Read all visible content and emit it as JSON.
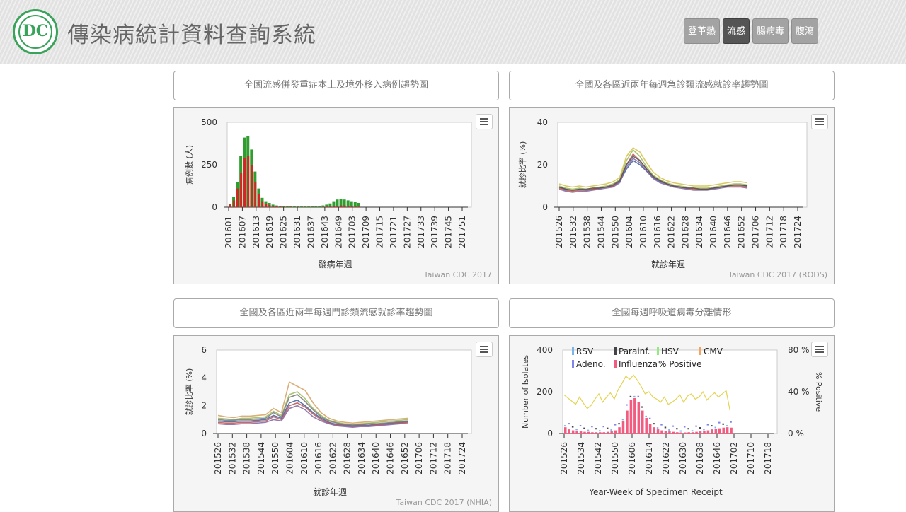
{
  "header": {
    "logo_text": "DC",
    "title": "傳染病統計資料查詢系統",
    "nav": [
      {
        "label": "登革熱",
        "active": false
      },
      {
        "label": "流感",
        "active": true
      },
      {
        "label": "腸病毒",
        "active": false
      },
      {
        "label": "腹瀉",
        "active": false
      }
    ]
  },
  "panels": [
    {
      "title": "全國流感併發重症本土及境外移入病例趨勢圖",
      "credit": "Taiwan CDC 2017"
    },
    {
      "title": "全國及各區近兩年每週急診類流感就診率趨勢圖",
      "credit": "Taiwan CDC 2017 (RODS)"
    },
    {
      "title": "全國及各區近兩年每週門診類流感就診率趨勢圖",
      "credit": "Taiwan CDC 2017 (NHIA)"
    },
    {
      "title": "全國每週呼吸道病毒分離情形",
      "credit": ""
    }
  ],
  "chart_data": [
    {
      "type": "bar",
      "ylabel": "病例數 (人)",
      "xlabel": "發病年週",
      "ylim": [
        0,
        500
      ],
      "yticks": [
        "0",
        "250",
        "500"
      ],
      "xtick_labels": [
        "201601",
        "201607",
        "201613",
        "201619",
        "201625",
        "201631",
        "201637",
        "201643",
        "201649",
        "201703",
        "201709",
        "201715",
        "201721",
        "201727",
        "201733",
        "201739",
        "201745",
        "201751"
      ],
      "series": [
        {
          "name": "",
          "color": "#d62424",
          "values": [
            15,
            40,
            110,
            200,
            290,
            300,
            250,
            150,
            75,
            35,
            20,
            12,
            6,
            4,
            3,
            2,
            2,
            2,
            1,
            1,
            1,
            1,
            1,
            1,
            1,
            1,
            2,
            3,
            4,
            6,
            8,
            10,
            10,
            8,
            6,
            4,
            3
          ]
        },
        {
          "name": "",
          "color": "#2f9e2f",
          "values": [
            20,
            60,
            150,
            300,
            410,
            420,
            340,
            210,
            110,
            55,
            35,
            25,
            15,
            10,
            8,
            6,
            6,
            6,
            5,
            5,
            4,
            4,
            4,
            5,
            6,
            8,
            10,
            15,
            22,
            35,
            45,
            50,
            45,
            40,
            35,
            30,
            25
          ]
        }
      ]
    },
    {
      "type": "line",
      "ylabel": "就診比率 (%)",
      "xlabel": "就診年週",
      "ylim": [
        0,
        40
      ],
      "yticks": [
        "0",
        "20",
        "40"
      ],
      "xtick_labels": [
        "201526",
        "201532",
        "201538",
        "201544",
        "201550",
        "201604",
        "201610",
        "201616",
        "201622",
        "201628",
        "201634",
        "201640",
        "201646",
        "201652",
        "201706",
        "201712",
        "201718",
        "201724"
      ],
      "series": [
        {
          "name": "",
          "color": "#3a5fa0",
          "values": [
            9.5,
            8.5,
            8,
            8.5,
            8,
            8.5,
            9,
            9.5,
            10,
            12,
            18,
            22,
            20,
            17,
            14,
            12,
            11,
            10,
            9.5,
            9,
            9,
            8.5,
            8.5,
            9,
            9.5,
            10,
            10.5,
            10.5,
            10
          ]
        },
        {
          "name": "",
          "color": "#9bbb59",
          "values": [
            10,
            9,
            8.5,
            9,
            8.5,
            9,
            9.5,
            10,
            11,
            13,
            22,
            27,
            24,
            19,
            15,
            13,
            11.5,
            10.5,
            10,
            9.5,
            9,
            9,
            9,
            9.5,
            10,
            10.5,
            11,
            11,
            10.5
          ]
        },
        {
          "name": "",
          "color": "#c0504d",
          "values": [
            9,
            8,
            7.5,
            8,
            8,
            8.5,
            9,
            9.5,
            10,
            12.5,
            20,
            25,
            22,
            18,
            14.5,
            12.5,
            11,
            10,
            9.5,
            9,
            8.5,
            8.5,
            8.5,
            9,
            9.5,
            10,
            10,
            10,
            9.5
          ]
        },
        {
          "name": "",
          "color": "#d6c046",
          "values": [
            11,
            10,
            9.5,
            10,
            9.5,
            10,
            10.5,
            11,
            12,
            14,
            24,
            28,
            26,
            21,
            16.5,
            14,
            12.5,
            11.5,
            11,
            10.5,
            10,
            10,
            10,
            10.5,
            11,
            11.5,
            12,
            12,
            11.5
          ]
        },
        {
          "name": "",
          "color": "#8064a2",
          "values": [
            8.5,
            7.5,
            7,
            7.5,
            7.5,
            8,
            8.5,
            9,
            9.5,
            11.5,
            19,
            23,
            21,
            17,
            13.5,
            11.5,
            10.5,
            9.5,
            9,
            8.5,
            8,
            8,
            8,
            8.5,
            9,
            9.5,
            9.5,
            9.5,
            9
          ]
        },
        {
          "name": "",
          "color": "#555555",
          "values": [
            9.5,
            8.5,
            8,
            8.5,
            8.5,
            9,
            9,
            9.5,
            10.5,
            12.5,
            20,
            24,
            22,
            18,
            14.5,
            12.5,
            11,
            10,
            9.5,
            9,
            9,
            8.5,
            8.5,
            9,
            9.5,
            10,
            10.5,
            10.5,
            10
          ]
        }
      ]
    },
    {
      "type": "line",
      "ylabel": "就診比率 (%)",
      "xlabel": "就診年週",
      "ylim": [
        0,
        6
      ],
      "yticks": [
        "0",
        "2",
        "4",
        "6"
      ],
      "xtick_labels": [
        "201526",
        "201532",
        "201538",
        "201544",
        "201550",
        "201604",
        "201610",
        "201616",
        "201622",
        "201628",
        "201634",
        "201640",
        "201646",
        "201652",
        "201706",
        "201712",
        "201718",
        "201724"
      ],
      "series": [
        {
          "name": "",
          "color": "#3a5fa0",
          "values": [
            0.9,
            0.85,
            0.85,
            0.9,
            0.9,
            0.95,
            1.0,
            1.3,
            1.1,
            2.2,
            2.4,
            2.0,
            1.5,
            1.1,
            0.8,
            0.65,
            0.6,
            0.55,
            0.6,
            0.6,
            0.65,
            0.7,
            0.75,
            0.8,
            0.85
          ]
        },
        {
          "name": "",
          "color": "#9bbb59",
          "values": [
            1.1,
            1.05,
            1.0,
            1.1,
            1.1,
            1.15,
            1.2,
            1.6,
            1.3,
            2.8,
            3.0,
            2.5,
            1.8,
            1.3,
            0.95,
            0.8,
            0.7,
            0.65,
            0.7,
            0.75,
            0.8,
            0.85,
            0.9,
            0.95,
            1.0
          ]
        },
        {
          "name": "",
          "color": "#c0504d",
          "values": [
            0.8,
            0.75,
            0.75,
            0.8,
            0.8,
            0.85,
            0.9,
            1.2,
            1.0,
            2.0,
            2.2,
            1.9,
            1.4,
            1.0,
            0.75,
            0.6,
            0.55,
            0.5,
            0.55,
            0.55,
            0.6,
            0.65,
            0.7,
            0.75,
            0.8
          ]
        },
        {
          "name": "",
          "color": "#d6a060",
          "values": [
            1.3,
            1.2,
            1.15,
            1.25,
            1.25,
            1.3,
            1.35,
            1.8,
            1.5,
            3.7,
            3.4,
            3.1,
            2.2,
            1.5,
            1.1,
            0.9,
            0.8,
            0.75,
            0.8,
            0.85,
            0.9,
            0.95,
            1.0,
            1.05,
            1.1
          ]
        },
        {
          "name": "",
          "color": "#8064a2",
          "values": [
            0.7,
            0.65,
            0.65,
            0.7,
            0.7,
            0.75,
            0.8,
            1.0,
            0.9,
            1.8,
            2.0,
            1.7,
            1.2,
            0.9,
            0.7,
            0.55,
            0.5,
            0.45,
            0.5,
            0.5,
            0.55,
            0.6,
            0.65,
            0.7,
            0.7
          ]
        },
        {
          "name": "",
          "color": "#777777",
          "values": [
            1.0,
            0.95,
            0.95,
            1.0,
            1.0,
            1.05,
            1.1,
            1.5,
            1.2,
            2.6,
            2.8,
            2.3,
            1.7,
            1.2,
            0.9,
            0.75,
            0.65,
            0.6,
            0.65,
            0.7,
            0.7,
            0.75,
            0.8,
            0.85,
            0.9
          ]
        }
      ]
    },
    {
      "type": "bar",
      "ylabel": "Number of Isolates",
      "y2label": "% Positive",
      "xlabel": "Year-Week of Specimen Receipt",
      "ylim": [
        0,
        400
      ],
      "y2lim": [
        0,
        80
      ],
      "yticks": [
        "0",
        "200",
        "400"
      ],
      "y2ticks": [
        "0 %",
        "40 %",
        "80 %"
      ],
      "xtick_labels": [
        "201526",
        "201534",
        "201542",
        "201550",
        "201606",
        "201614",
        "201622",
        "201630",
        "201638",
        "201646",
        "201702",
        "201710",
        "201718"
      ],
      "legend": [
        "RSV",
        "Parainf.",
        "HSV",
        "CMV",
        "Adeno.",
        "Influenza",
        "% Positive"
      ],
      "legend_colors": [
        "#7cb5ec",
        "#434348",
        "#90ed7d",
        "#f7a35c",
        "#8085e9",
        "#f15c80",
        "#e4d354"
      ],
      "influenza": [
        30,
        20,
        15,
        12,
        10,
        8,
        8,
        6,
        6,
        6,
        6,
        8,
        10,
        15,
        30,
        60,
        110,
        160,
        170,
        150,
        110,
        75,
        45,
        30,
        20,
        15,
        12,
        10,
        8,
        6,
        5,
        5,
        6,
        6,
        8,
        10,
        12,
        15,
        20,
        22,
        25,
        28,
        30,
        28
      ],
      "pct_positive": [
        37,
        34,
        31,
        28,
        35,
        29,
        24,
        27,
        33,
        38,
        30,
        35,
        39,
        33,
        42,
        48,
        55,
        52,
        56,
        51,
        45,
        38,
        40,
        35,
        33,
        30,
        35,
        28,
        30,
        33,
        37,
        30,
        36,
        38,
        33,
        35,
        40,
        32,
        36,
        39,
        35,
        38,
        41,
        22
      ]
    }
  ]
}
